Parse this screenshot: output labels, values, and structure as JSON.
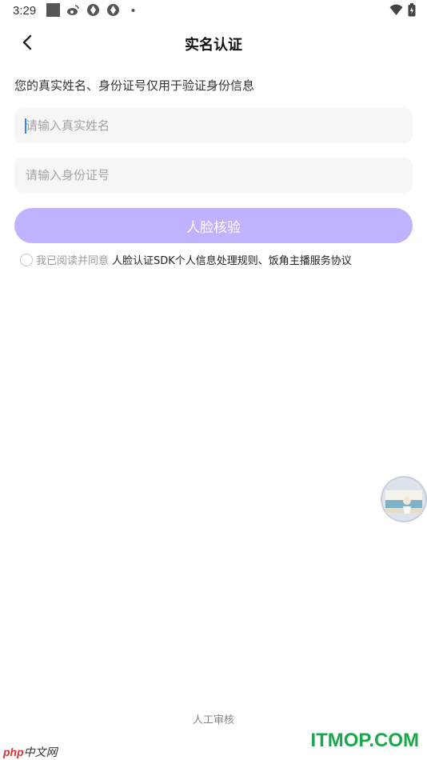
{
  "status_bar": {
    "time": "3:29",
    "icons": [
      "notification-square-icon",
      "weibo-icon",
      "app-icon",
      "app-icon",
      "dot-icon"
    ],
    "right_icons": [
      "wifi-icon",
      "battery-icon"
    ]
  },
  "header": {
    "title": "实名认证",
    "back_icon": "chevron-left-icon"
  },
  "form": {
    "hint": "您的真实姓名、身份证号仅用于验证身份信息",
    "name_placeholder": "请输入真实姓名",
    "id_placeholder": "请输入身份证号",
    "submit_label": "人脸核验",
    "submit_color": "#c1b2ff"
  },
  "agreement": {
    "prefix": "我已阅读并同意",
    "links": "人脸认证SDK个人信息处理规则、饭角主播服务协议",
    "checked": false
  },
  "footer": {
    "manual_review": "人工审核"
  },
  "watermarks": {
    "left_brand": "php",
    "left_site": "中文网",
    "right_site": "ITMOP.COM"
  }
}
